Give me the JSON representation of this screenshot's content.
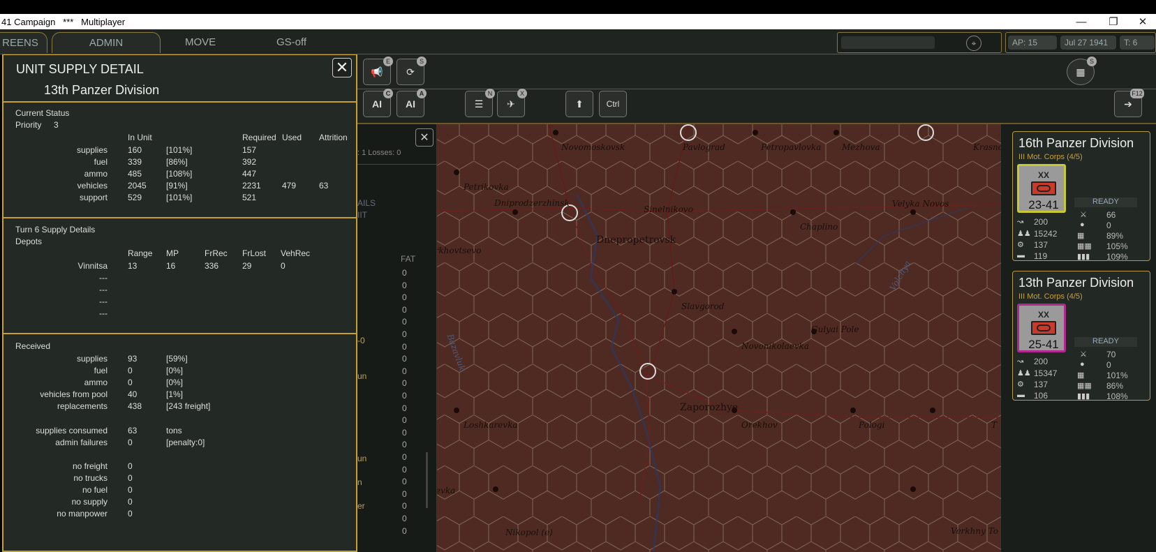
{
  "window": {
    "title": "41 Campaign   ***   Multiplayer",
    "minimize": "—",
    "maximize": "❐",
    "close": "✕"
  },
  "menu": {
    "screens": "REENS",
    "admin": "ADMIN",
    "move": "MOVE",
    "gs": "GS-off",
    "ap": "AP: 15",
    "date": "Jul 27 1941",
    "turn": "T: 6"
  },
  "toolbar": {
    "ai1": "AI",
    "ai2": "AI",
    "ctrl": "Ctrl",
    "badge_e": "E",
    "badge_s": "S",
    "badge_c": "C",
    "badge_a": "A",
    "badge_n": "N",
    "badge_x": "X",
    "badge_s2": "S",
    "badge_f": "F12"
  },
  "supply": {
    "title": "UNIT SUPPLY DETAIL",
    "unit": "13th Panzer Division",
    "close": "✕",
    "current": {
      "heading": "Current Status",
      "priority_label": "Priority",
      "priority": "3",
      "cols": [
        "In Unit",
        "Required",
        "Used",
        "Attrition"
      ],
      "rows": [
        {
          "label": "supplies",
          "inunit": "160",
          "pct": "[101%]",
          "req": "157",
          "used": "",
          "attr": ""
        },
        {
          "label": "fuel",
          "inunit": "339",
          "pct": "[86%]",
          "req": "392",
          "used": "",
          "attr": ""
        },
        {
          "label": "ammo",
          "inunit": "485",
          "pct": "[108%]",
          "req": "447",
          "used": "",
          "attr": ""
        },
        {
          "label": "vehicles",
          "inunit": "2045",
          "pct": "[91%]",
          "req": "2231",
          "used": "479",
          "attr": "63"
        },
        {
          "label": "support",
          "inunit": "529",
          "pct": "[101%]",
          "req": "521",
          "used": "",
          "attr": ""
        }
      ]
    },
    "turn": {
      "heading": "Turn 6 Supply Details",
      "depots": "Depots",
      "cols": [
        "Range",
        "MP",
        "FrRec",
        "FrLost",
        "VehRec"
      ],
      "rows": [
        {
          "name": "Vinnitsa",
          "range": "13",
          "mp": "16",
          "frrec": "336",
          "frlost": "29",
          "vehrec": "0"
        },
        {
          "name": "---"
        },
        {
          "name": "---"
        },
        {
          "name": "---"
        },
        {
          "name": "---"
        }
      ]
    },
    "received": {
      "heading": "Received",
      "rows": [
        {
          "label": "supplies",
          "v": "93",
          "p": "[59%]"
        },
        {
          "label": "fuel",
          "v": "0",
          "p": "[0%]"
        },
        {
          "label": "ammo",
          "v": "0",
          "p": "[0%]"
        },
        {
          "label": "vehicles from pool",
          "v": "40",
          "p": "[1%]"
        },
        {
          "label": "replacements",
          "v": "438",
          "p": "[243 freight]"
        }
      ],
      "consumed": {
        "label": "supplies consumed",
        "v": "63",
        "p": "tons"
      },
      "admin": {
        "label": "admin failures",
        "v": "0",
        "p": "[penalty:0]"
      },
      "fails": [
        {
          "label": "no freight",
          "v": "0"
        },
        {
          "label": "no trucks",
          "v": "0"
        },
        {
          "label": "no fuel",
          "v": "0"
        },
        {
          "label": "no supply",
          "v": "0"
        },
        {
          "label": "no manpower",
          "v": "0"
        }
      ]
    }
  },
  "mid": {
    "close": "✕",
    "losses": ": 1 Losses: 0",
    "frag": [
      "AILS",
      "IIT",
      "-0",
      "un",
      "un",
      "n",
      "er"
    ],
    "fat_head": "FAT",
    "fat": [
      "0",
      "0",
      "0",
      "0",
      "0",
      "0",
      "0",
      "0",
      "0",
      "0",
      "0",
      "0",
      "0",
      "0",
      "0",
      "0",
      "0",
      "0",
      "0",
      "0",
      "0",
      "0"
    ]
  },
  "map": {
    "cities": [
      "Dnepropetrovsk",
      "Zaporozhye"
    ],
    "towns": [
      "Novomoskovsk",
      "Pavlograd",
      "Petropavlovka",
      "Mezhova",
      "Krasno",
      "Petrikovka",
      "Dniprodzerzhinsk",
      "Sinelnikovo",
      "Velyka Novos",
      "Chaplino",
      "Verkhovtsevo",
      "Slavgorod",
      "Gulyai Pole",
      "Novonikolaevka",
      "Loshkarevka",
      "Orekhov",
      "Pologi",
      "T",
      "Nikopol (e)",
      "Verkhny To",
      "evka"
    ],
    "rivers": [
      "Volchya",
      "Bazavluk"
    ]
  },
  "cards": [
    {
      "name": "16th Panzer Division",
      "corps": "III Mot. Corps (4/5)",
      "xx": "XX",
      "strength": "23-41",
      "status": "READY",
      "mp": "200",
      "men": "15242",
      "guns": "137",
      "afv": "119",
      "cv": "66",
      "fat": "0",
      "p1": "89%",
      "p2": "105%",
      "p3": "109%",
      "border": "#c8c830"
    },
    {
      "name": "13th Panzer Division",
      "corps": "III Mot. Corps (4/5)",
      "xx": "XX",
      "strength": "25-41",
      "status": "READY",
      "mp": "200",
      "men": "15347",
      "guns": "137",
      "afv": "106",
      "cv": "70",
      "fat": "0",
      "p1": "101%",
      "p2": "86%",
      "p3": "108%",
      "border": "#b02890"
    }
  ]
}
